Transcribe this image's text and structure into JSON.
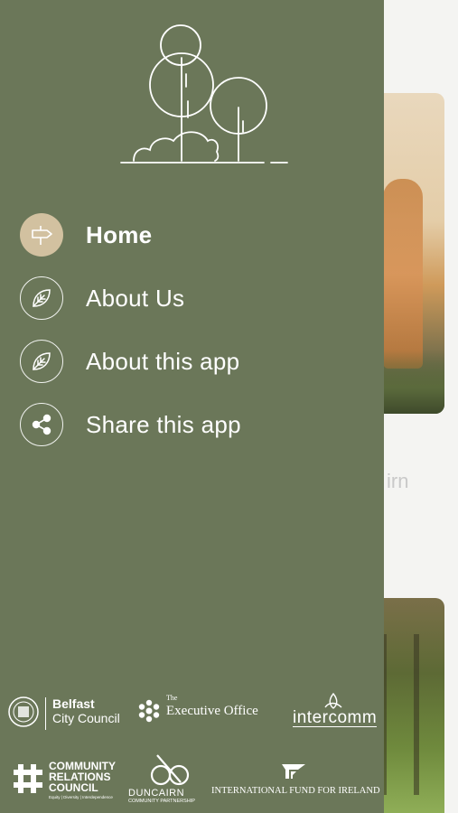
{
  "menu": {
    "items": [
      {
        "label": "Home",
        "icon": "signpost-icon",
        "active": true
      },
      {
        "label": "About Us",
        "icon": "leaf-icon",
        "active": false
      },
      {
        "label": "About this app",
        "icon": "leaf-icon",
        "active": false
      },
      {
        "label": "Share this app",
        "icon": "share-icon",
        "active": false
      }
    ]
  },
  "background": {
    "partial_text": "irn"
  },
  "sponsors": {
    "belfast_line1": "Belfast",
    "belfast_line2": "City Council",
    "executive_small": "The",
    "executive_name": "Executive Office",
    "intercomm": "intercomm",
    "crc_line1": "COMMUNITY",
    "crc_line2": "RELATIONS",
    "crc_line3": "COUNCIL",
    "crc_tagline": "Equity | Diversity | Interdependence",
    "duncairn_line1": "DUNCAIRN",
    "duncairn_line2": "COMMUNITY PARTNERSHIP",
    "ifi": "INTERNATIONAL FUND FOR IRELAND"
  },
  "colors": {
    "drawer": "#6b7759",
    "active_icon": "#d2c1a0",
    "text": "#ffffff"
  }
}
